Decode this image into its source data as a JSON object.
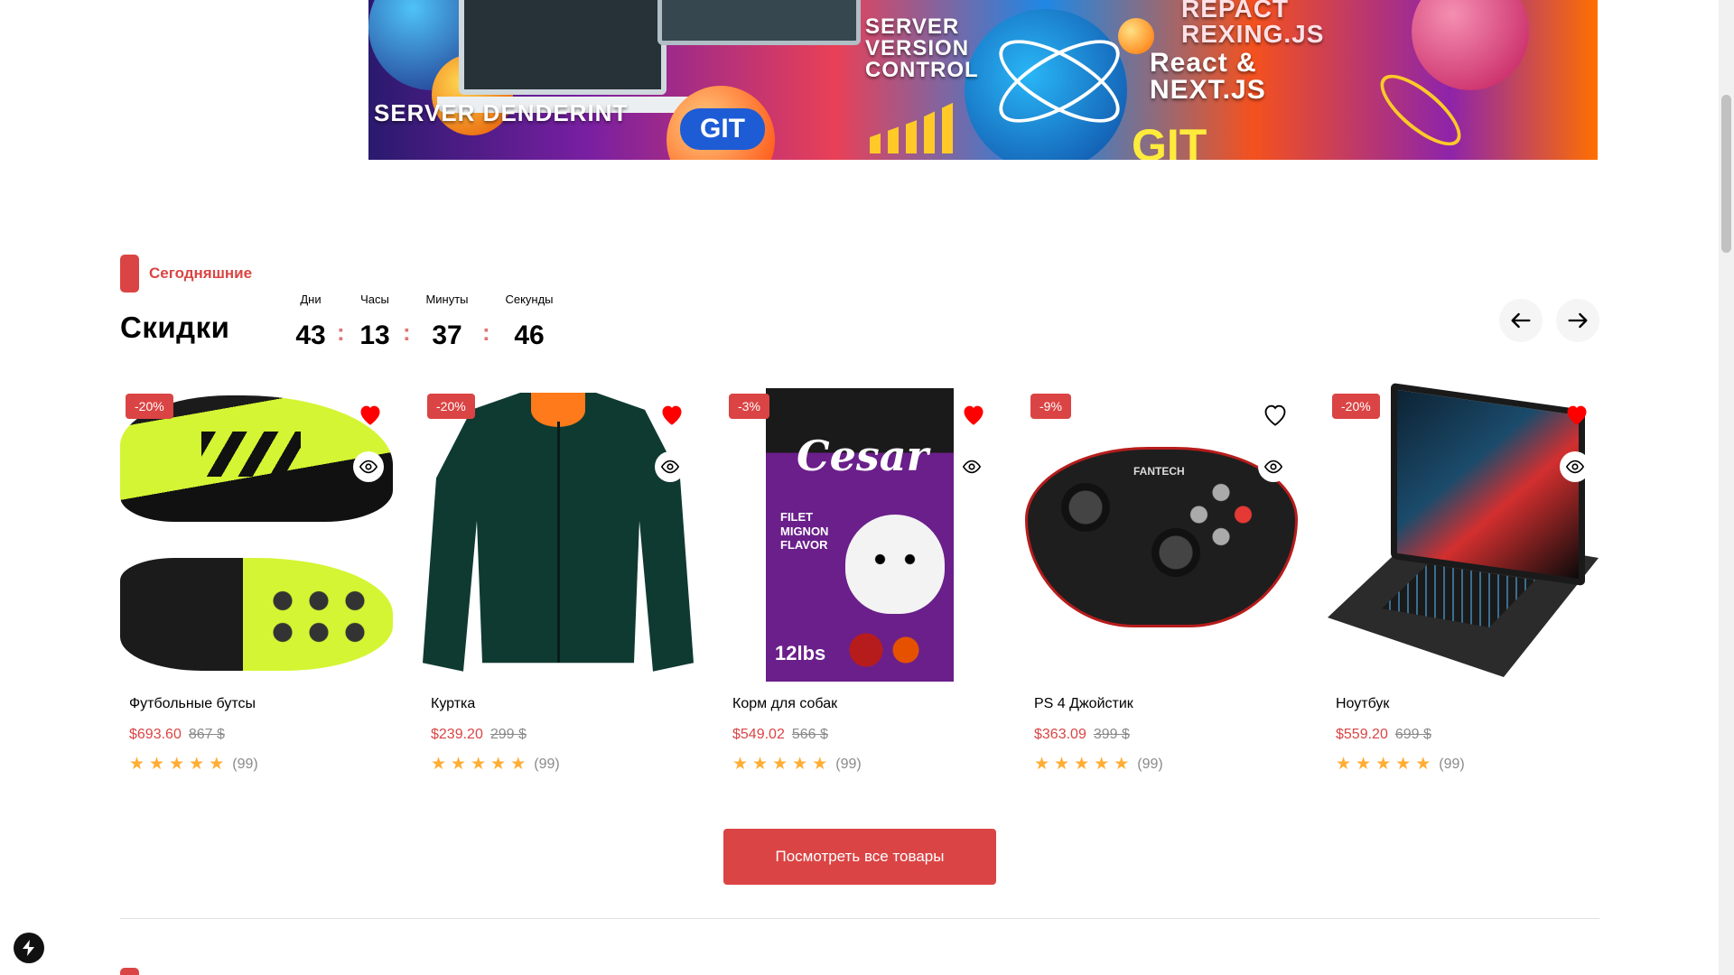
{
  "banner": {
    "texts": [
      "SERVER DENDERINT",
      "SERVER VERSION CONTROL",
      "React & NEXT.JS",
      "REPACT REXING.JS"
    ],
    "git_label": "GIT",
    "git_label_2": "GIT"
  },
  "section": {
    "tag_label": "Сегодняшние",
    "title": "Скидки"
  },
  "timer": {
    "days_label": "Дни",
    "hours_label": "Часы",
    "minutes_label": "Минуты",
    "seconds_label": "Секунды",
    "days": "43",
    "hours": "13",
    "minutes": "37",
    "seconds": "46",
    "separator": ":"
  },
  "nav": {
    "prev_icon": "arrow-left-icon",
    "next_icon": "arrow-right-icon"
  },
  "products": [
    {
      "name": "Футбольные бутсы",
      "discount": "-20%",
      "price": "$693.60",
      "old_price": "867 $",
      "reviews": "(99)",
      "rating": 5,
      "favorite": true
    },
    {
      "name": "Куртка",
      "discount": "-20%",
      "price": "$239.20",
      "old_price": "299 $",
      "reviews": "(99)",
      "rating": 5,
      "favorite": true
    },
    {
      "name": "Корм для собак",
      "discount": "-3%",
      "price": "$549.02",
      "old_price": "566 $",
      "reviews": "(99)",
      "rating": 5,
      "favorite": true
    },
    {
      "name": "PS 4 Джойстик",
      "discount": "-9%",
      "price": "$363.09",
      "old_price": "399 $",
      "reviews": "(99)",
      "rating": 5,
      "favorite": false
    },
    {
      "name": "Ноутбук",
      "discount": "-20%",
      "price": "$559.20",
      "old_price": "699 $",
      "reviews": "(99)",
      "rating": 5,
      "favorite": true
    }
  ],
  "product_art": {
    "dogfood_brand": "Cesar",
    "dogfood_flavor": "FILET MIGNON FLAVOR",
    "dogfood_weight": "12lbs",
    "gamepad_brand": "FANTECH"
  },
  "actions": {
    "view_all_label": "Посмотреть все товары"
  },
  "colors": {
    "accent": "#db4444",
    "star": "#ffad33",
    "muted": "#8a8a8a"
  }
}
